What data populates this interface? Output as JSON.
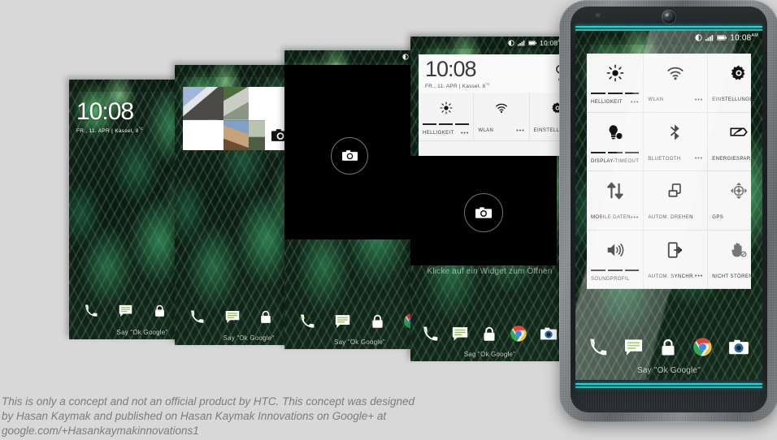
{
  "caption": {
    "line1": "This is only a concept and not an official product by HTC. This concept was designed",
    "line2": "by Hasan Kaymak and published on Hasan Kaymak Innovations on Google+ at",
    "line3": "google.com/+Hasankaymakinnovations1"
  },
  "statusbar": {
    "time": "10:08",
    "meridiem": "AM",
    "icons": [
      "do-not-disturb-icon",
      "signal-icon",
      "battery-icon"
    ]
  },
  "clock_widget": {
    "time": "10:08",
    "date": "FR., 11. APR | Kassel, 8",
    "degree": "°C"
  },
  "dock": {
    "items": [
      {
        "name": "phone",
        "icon": "phone-icon"
      },
      {
        "name": "messages",
        "icon": "message-icon"
      },
      {
        "name": "lock",
        "icon": "lock-icon"
      },
      {
        "name": "chrome",
        "icon": "chrome-icon"
      },
      {
        "name": "camera",
        "icon": "camera-icon"
      }
    ],
    "hint": "Say \"Ok Google\"",
    "hint_de": "Sag \"Ok Google\""
  },
  "widget_picker": {
    "hint": "Klicke auf ein Widget zum Öffnen",
    "camera_widget_icon": "camera-icon"
  },
  "quick_settings": {
    "tiles": [
      {
        "label": "HELLIGKEIT",
        "icon": "brightness-icon",
        "dots": "•••",
        "bars": true
      },
      {
        "label": "WLAN",
        "icon": "wifi-icon",
        "dots": "•••",
        "bars": false
      },
      {
        "label": "EINSTELLUNGEN",
        "icon": "gear-icon",
        "dots": "",
        "bars": false
      },
      {
        "label": "DISPLAY-TIMEOUT",
        "icon": "bulb-icon",
        "dots": "",
        "bars": true
      },
      {
        "label": "BLUETOOTH",
        "icon": "bluetooth-icon",
        "dots": "•••",
        "bars": false
      },
      {
        "label": "ENERGIESPARM.",
        "icon": "powersave-icon",
        "dots": "•••",
        "bars": false
      },
      {
        "label": "MOBILE DATEN",
        "icon": "mobiledata-icon",
        "dots": "•••",
        "bars": false
      },
      {
        "label": "AUTOM. DREHEN",
        "icon": "autorotate-icon",
        "dots": "",
        "bars": false
      },
      {
        "label": "GPS",
        "icon": "gps-icon",
        "dots": "•••",
        "bars": false
      },
      {
        "label": "SOUNDPROFIL",
        "icon": "volume-icon",
        "dots": "",
        "bars": true
      },
      {
        "label": "AUTOM. SYNCHR.",
        "icon": "autosync-icon",
        "dots": "•••",
        "bars": false
      },
      {
        "label": "NICHT STÖREN",
        "icon": "donotdisturb-icon",
        "dots": "•••",
        "bars": false
      }
    ]
  },
  "photo_widget": {
    "camera_icon": "camera-icon",
    "tiles": [
      "photo-bridge",
      "photo-hands",
      "photo-bench",
      "photo-vintage",
      "photo-camera-tile",
      "photo-gazebo",
      "photo-lawn"
    ]
  },
  "colors": {
    "accent_teal": "#1fd6d6",
    "panel_bg": "#f4f4f4",
    "page_bg": "#d8d8d8",
    "caption_text": "#7c7c7c"
  }
}
